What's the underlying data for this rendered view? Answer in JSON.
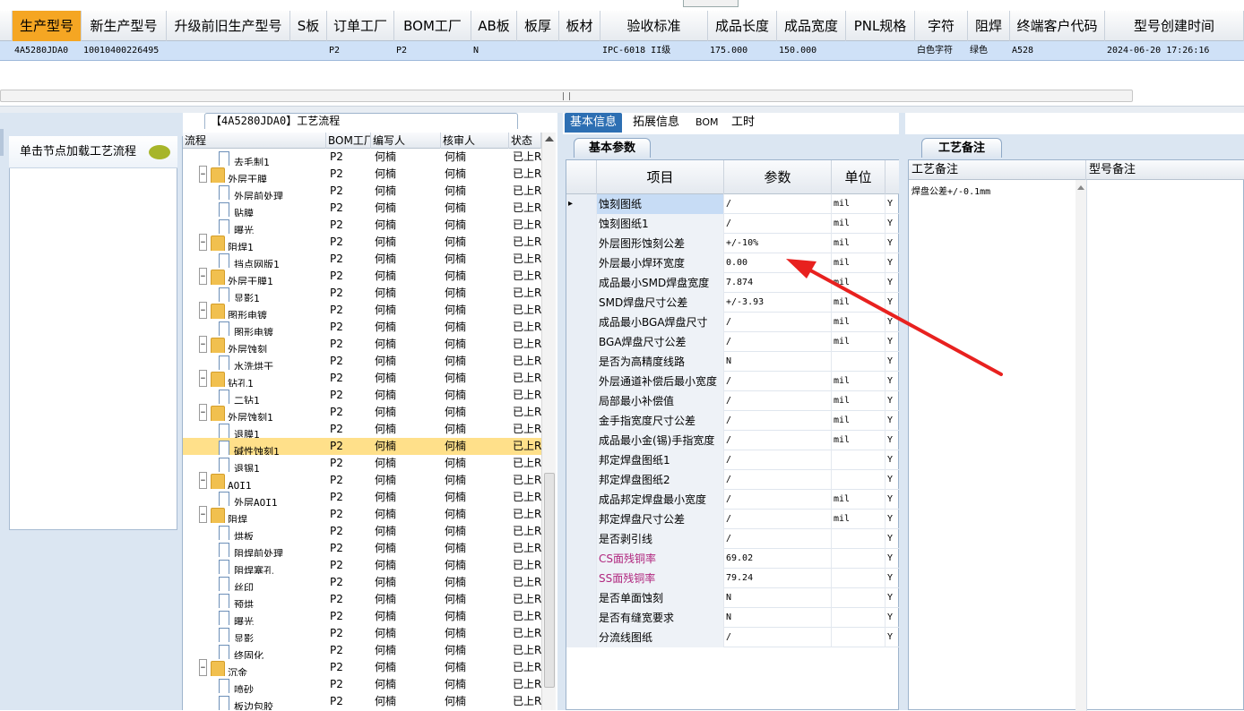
{
  "top_grid": {
    "columns": [
      "生产型号",
      "新生产型号",
      "升级前旧生产型号",
      "S板",
      "订单工厂",
      "BOM工厂",
      "AB板",
      "板厚",
      "板材",
      "验收标准",
      "成品长度",
      "成品宽度",
      "PNL规格",
      "字符",
      "阻焊",
      "终端客户代码",
      "型号创建时间"
    ],
    "row": {
      "生产型号": "4A5280JDA0",
      "新生产型号": "10010400226495",
      "订单工厂": "P2",
      "BOM工厂": "P2",
      "AB板": "N",
      "验收标准": "IPC-6018 II级",
      "成品长度": "175.000",
      "成品宽度": "150.000",
      "字符": "白色字符",
      "阻焊": "绿色",
      "终端客户代码": "A528",
      "型号创建时间": "2024-06-20 17:26:16"
    }
  },
  "left_panel": {
    "tab_label": "单击节点加载工艺流程"
  },
  "tree": {
    "title": "【4A5280JDA0】工艺流程",
    "headers": [
      "流程",
      "BOM工厂",
      "编写人",
      "核审人",
      "状态"
    ],
    "rows": [
      {
        "name": "去毛制1",
        "level": 2,
        "type": "file",
        "bom": "P2",
        "writer": "何楠",
        "reviewer": "何楠",
        "status": "已上R"
      },
      {
        "name": "外层干膜",
        "level": 1,
        "type": "folder",
        "bom": "P2",
        "writer": "何楠",
        "reviewer": "何楠",
        "status": "已上R"
      },
      {
        "name": "外层前处理",
        "level": 2,
        "type": "file",
        "bom": "P2",
        "writer": "何楠",
        "reviewer": "何楠",
        "status": "已上R"
      },
      {
        "name": "贴膜",
        "level": 2,
        "type": "file",
        "bom": "P2",
        "writer": "何楠",
        "reviewer": "何楠",
        "status": "已上R"
      },
      {
        "name": "曝光",
        "level": 2,
        "type": "file",
        "bom": "P2",
        "writer": "何楠",
        "reviewer": "何楠",
        "status": "已上R"
      },
      {
        "name": "阻焊1",
        "level": 1,
        "type": "folder",
        "bom": "P2",
        "writer": "何楠",
        "reviewer": "何楠",
        "status": "已上R"
      },
      {
        "name": "挡点网版1",
        "level": 2,
        "type": "file",
        "bom": "P2",
        "writer": "何楠",
        "reviewer": "何楠",
        "status": "已上R"
      },
      {
        "name": "外层干膜1",
        "level": 1,
        "type": "folder",
        "bom": "P2",
        "writer": "何楠",
        "reviewer": "何楠",
        "status": "已上R"
      },
      {
        "name": "显影1",
        "level": 2,
        "type": "file",
        "bom": "P2",
        "writer": "何楠",
        "reviewer": "何楠",
        "status": "已上R"
      },
      {
        "name": "图形电镀",
        "level": 1,
        "type": "folder",
        "bom": "P2",
        "writer": "何楠",
        "reviewer": "何楠",
        "status": "已上R"
      },
      {
        "name": "图形电镀",
        "level": 2,
        "type": "file",
        "bom": "P2",
        "writer": "何楠",
        "reviewer": "何楠",
        "status": "已上R"
      },
      {
        "name": "外层蚀刻",
        "level": 1,
        "type": "folder",
        "bom": "P2",
        "writer": "何楠",
        "reviewer": "何楠",
        "status": "已上R"
      },
      {
        "name": "水洗烘干",
        "level": 2,
        "type": "file",
        "bom": "P2",
        "writer": "何楠",
        "reviewer": "何楠",
        "status": "已上R"
      },
      {
        "name": "钻孔1",
        "level": 1,
        "type": "folder",
        "bom": "P2",
        "writer": "何楠",
        "reviewer": "何楠",
        "status": "已上R"
      },
      {
        "name": "二钻1",
        "level": 2,
        "type": "file",
        "bom": "P2",
        "writer": "何楠",
        "reviewer": "何楠",
        "status": "已上R"
      },
      {
        "name": "外层蚀刻1",
        "level": 1,
        "type": "folder",
        "bom": "P2",
        "writer": "何楠",
        "reviewer": "何楠",
        "status": "已上R"
      },
      {
        "name": "退膜1",
        "level": 2,
        "type": "file",
        "bom": "P2",
        "writer": "何楠",
        "reviewer": "何楠",
        "status": "已上R"
      },
      {
        "name": "碱性蚀刻1",
        "level": 2,
        "type": "file",
        "bom": "P2",
        "writer": "何楠",
        "reviewer": "何楠",
        "status": "已上R",
        "selected": true
      },
      {
        "name": "退锡1",
        "level": 2,
        "type": "file",
        "bom": "P2",
        "writer": "何楠",
        "reviewer": "何楠",
        "status": "已上R"
      },
      {
        "name": "AOI1",
        "level": 1,
        "type": "folder",
        "bom": "P2",
        "writer": "何楠",
        "reviewer": "何楠",
        "status": "已上R"
      },
      {
        "name": "外层AOI1",
        "level": 2,
        "type": "file",
        "bom": "P2",
        "writer": "何楠",
        "reviewer": "何楠",
        "status": "已上R"
      },
      {
        "name": "阻焊",
        "level": 1,
        "type": "folder",
        "bom": "P2",
        "writer": "何楠",
        "reviewer": "何楠",
        "status": "已上R"
      },
      {
        "name": "烘板",
        "level": 2,
        "type": "file",
        "bom": "P2",
        "writer": "何楠",
        "reviewer": "何楠",
        "status": "已上R"
      },
      {
        "name": "阻焊前处理",
        "level": 2,
        "type": "file",
        "bom": "P2",
        "writer": "何楠",
        "reviewer": "何楠",
        "status": "已上R"
      },
      {
        "name": "阻焊塞孔",
        "level": 2,
        "type": "file",
        "bom": "P2",
        "writer": "何楠",
        "reviewer": "何楠",
        "status": "已上R"
      },
      {
        "name": "丝印",
        "level": 2,
        "type": "file",
        "bom": "P2",
        "writer": "何楠",
        "reviewer": "何楠",
        "status": "已上R"
      },
      {
        "name": "预烘",
        "level": 2,
        "type": "file",
        "bom": "P2",
        "writer": "何楠",
        "reviewer": "何楠",
        "status": "已上R"
      },
      {
        "name": "曝光",
        "level": 2,
        "type": "file",
        "bom": "P2",
        "writer": "何楠",
        "reviewer": "何楠",
        "status": "已上R"
      },
      {
        "name": "显影",
        "level": 2,
        "type": "file",
        "bom": "P2",
        "writer": "何楠",
        "reviewer": "何楠",
        "status": "已上R"
      },
      {
        "name": "终固化",
        "level": 2,
        "type": "file",
        "bom": "P2",
        "writer": "何楠",
        "reviewer": "何楠",
        "status": "已上R"
      },
      {
        "name": "沉金",
        "level": 1,
        "type": "folder",
        "bom": "P2",
        "writer": "何楠",
        "reviewer": "何楠",
        "status": "已上R"
      },
      {
        "name": "喷砂",
        "level": 2,
        "type": "file",
        "bom": "P2",
        "writer": "何楠",
        "reviewer": "何楠",
        "status": "已上R"
      },
      {
        "name": "板边包胶",
        "level": 2,
        "type": "file",
        "bom": "P2",
        "writer": "何楠",
        "reviewer": "何楠",
        "status": "已上R"
      }
    ]
  },
  "tabs": [
    "基本信息",
    "拓展信息",
    "BOM",
    "工时"
  ],
  "basic_params": {
    "panel_tab": "基本参数",
    "headers": [
      "项目",
      "参数",
      "单位"
    ],
    "rows": [
      {
        "item": "蚀刻图纸",
        "value": "/",
        "unit": "mil",
        "flag": "Y",
        "selected": true
      },
      {
        "item": "蚀刻图纸1",
        "value": "/",
        "unit": "mil",
        "flag": "Y"
      },
      {
        "item": "外层图形蚀刻公差",
        "value": "+/-10%",
        "unit": "mil",
        "flag": "Y"
      },
      {
        "item": "外层最小焊环宽度",
        "value": "0.00",
        "unit": "mil",
        "flag": "Y"
      },
      {
        "item": "成品最小SMD焊盘宽度",
        "value": "7.874",
        "unit": "mil",
        "flag": "Y"
      },
      {
        "item": "SMD焊盘尺寸公差",
        "value": "+/-3.93",
        "unit": "mil",
        "flag": "Y"
      },
      {
        "item": "成品最小BGA焊盘尺寸",
        "value": "/",
        "unit": "mil",
        "flag": "Y"
      },
      {
        "item": "BGA焊盘尺寸公差",
        "value": "/",
        "unit": "mil",
        "flag": "Y"
      },
      {
        "item": "是否为高精度线路",
        "value": "N",
        "unit": "",
        "flag": "Y"
      },
      {
        "item": "外层通道补偿后最小宽度",
        "value": "/",
        "unit": "mil",
        "flag": "Y"
      },
      {
        "item": "局部最小补偿值",
        "value": "/",
        "unit": "mil",
        "flag": "Y"
      },
      {
        "item": "金手指宽度尺寸公差",
        "value": "/",
        "unit": "mil",
        "flag": "Y"
      },
      {
        "item": "成品最小金(锡)手指宽度",
        "value": "/",
        "unit": "mil",
        "flag": "Y"
      },
      {
        "item": "邦定焊盘图纸1",
        "value": "/",
        "unit": "",
        "flag": "Y"
      },
      {
        "item": "邦定焊盘图纸2",
        "value": "/",
        "unit": "",
        "flag": "Y"
      },
      {
        "item": "成品邦定焊盘最小宽度",
        "value": "/",
        "unit": "mil",
        "flag": "Y"
      },
      {
        "item": "邦定焊盘尺寸公差",
        "value": "/",
        "unit": "mil",
        "flag": "Y"
      },
      {
        "item": "是否剥引线",
        "value": "/",
        "unit": "",
        "flag": "Y"
      },
      {
        "item": "CS面残铜率",
        "value": "69.02",
        "unit": "",
        "flag": "Y",
        "highlight": true
      },
      {
        "item": "SS面残铜率",
        "value": "79.24",
        "unit": "",
        "flag": "Y",
        "highlight": true
      },
      {
        "item": "是否单面蚀刻",
        "value": "N",
        "unit": "",
        "flag": "Y"
      },
      {
        "item": "是否有缝宽要求",
        "value": "N",
        "unit": "",
        "flag": "Y"
      },
      {
        "item": "分流线图纸",
        "value": "/",
        "unit": "",
        "flag": "Y"
      }
    ]
  },
  "notes_panel": {
    "panel_tab": "工艺备注",
    "headers": [
      "工艺备注",
      "型号备注"
    ],
    "process_note": "焊盘公差+/-0.1mm"
  },
  "annotation": {
    "color": "#e8211f"
  }
}
